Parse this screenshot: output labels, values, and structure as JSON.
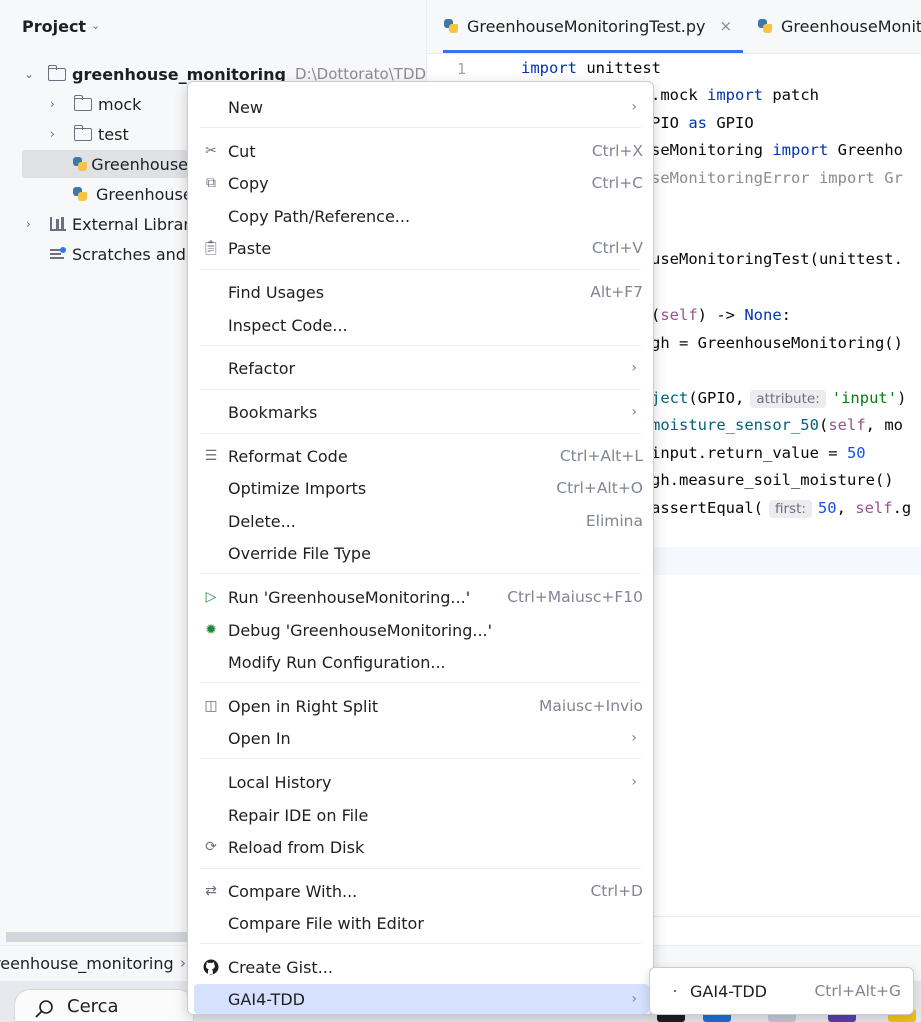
{
  "project_panel": {
    "title": "Project",
    "tree": [
      {
        "label": "greenhouse_monitoring",
        "path": "D:\\Dottorato\\TDD_"
      },
      {
        "label": "mock"
      },
      {
        "label": "test"
      },
      {
        "label": "Greenhouse"
      },
      {
        "label": "Greenhouse"
      },
      {
        "label": "External Librari"
      },
      {
        "label": "Scratches and"
      }
    ]
  },
  "editor": {
    "tabs": [
      {
        "label": "GreenhouseMonitoringTest.py",
        "close": "×"
      },
      {
        "label": "GreenhouseMonito"
      }
    ],
    "line_number": "1",
    "code": {
      "l1_kw": "import",
      "l1_rest": " unittest",
      "l2_a": ".mock ",
      "l2_kw": "import",
      "l2_b": " patch",
      "l3_a": "PIO ",
      "l3_kw": "as",
      "l3_b": " GPIO",
      "l4_a": "seMonitoring ",
      "l4_kw": "import",
      "l4_b": " Greenho",
      "l5": "seMonitoringError import Gr",
      "l6": "useMonitoringTest(unittest.",
      "l7_a": "(",
      "l7_self": "self",
      "l7_b": ") -> ",
      "l7_kw": "None",
      "l7_c": ":",
      "l8": "gh = GreenhouseMonitoring()",
      "l9_fn": "ject",
      "l9_a": "(GPIO,",
      "l9_hint": "attribute:",
      "l9_str": "'input'",
      "l9_b": ")",
      "l10_fn": "moisture_sensor_50",
      "l10_a": "(",
      "l10_self": "self",
      "l10_b": ", mo",
      "l11_a": "input.return_value = ",
      "l11_num": "50",
      "l12": "gh.measure_soil_moisture()",
      "l13_a": "assertEqual(",
      "l13_hint": "first:",
      "l13_num": "50",
      "l13_b": ", ",
      "l13_self": "self",
      "l13_c": ".g"
    }
  },
  "context_menu": {
    "items": [
      {
        "label": "New"
      },
      {
        "label": "Cut",
        "shortcut": "Ctrl+X"
      },
      {
        "label": "Copy",
        "shortcut": "Ctrl+C"
      },
      {
        "label": "Copy Path/Reference..."
      },
      {
        "label": "Paste",
        "shortcut": "Ctrl+V"
      },
      {
        "label": "Find Usages",
        "shortcut": "Alt+F7"
      },
      {
        "label": "Inspect Code..."
      },
      {
        "label": "Refactor"
      },
      {
        "label": "Bookmarks"
      },
      {
        "label": "Reformat Code",
        "shortcut": "Ctrl+Alt+L"
      },
      {
        "label": "Optimize Imports",
        "shortcut": "Ctrl+Alt+O"
      },
      {
        "label": "Delete...",
        "shortcut": "Elimina"
      },
      {
        "label": "Override File Type"
      },
      {
        "label": "Run 'GreenhouseMonitoring...'",
        "shortcut": "Ctrl+Maiusc+F10"
      },
      {
        "label": "Debug 'GreenhouseMonitoring...'"
      },
      {
        "label": "Modify Run Configuration..."
      },
      {
        "label": "Open in Right Split",
        "shortcut": "Maiusc+Invio"
      },
      {
        "label": "Open In"
      },
      {
        "label": "Local History"
      },
      {
        "label": "Repair IDE on File"
      },
      {
        "label": "Reload from Disk"
      },
      {
        "label": "Compare With...",
        "shortcut": "Ctrl+D"
      },
      {
        "label": "Compare File with Editor"
      },
      {
        "label": "Create Gist..."
      },
      {
        "label": "GAI4-TDD"
      }
    ]
  },
  "submenu": {
    "label": "GAI4-TDD",
    "shortcut": "Ctrl+Alt+G"
  },
  "breadcrumb": {
    "text": "reenhouse_monitoring",
    "sep": "›"
  },
  "taskbar": {
    "search_placeholder": "Cerca"
  },
  "colors": {
    "accent": "#3574f0",
    "highlight": "#d5e1ff",
    "keyword": "#0033b3",
    "string": "#067d17"
  }
}
